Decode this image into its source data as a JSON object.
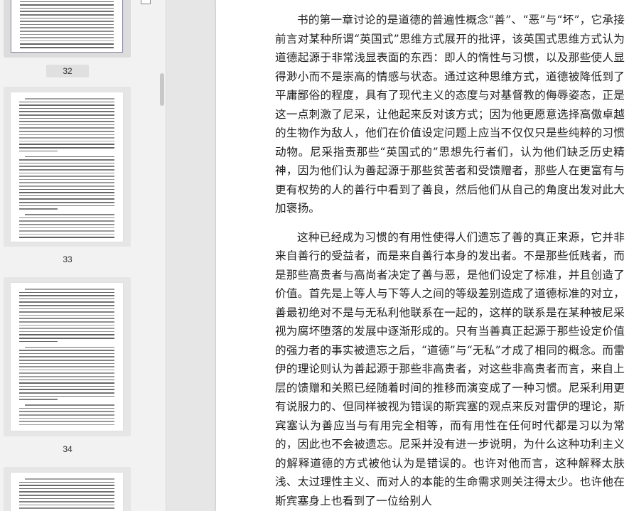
{
  "sidebar": {
    "thumbnails": [
      {
        "page_label": "32",
        "selected": true
      },
      {
        "page_label": "33",
        "selected": false
      },
      {
        "page_label": "34",
        "selected": false
      },
      {
        "page_label": "",
        "selected": false
      }
    ]
  },
  "document": {
    "paragraphs": [
      "书的第一章讨论的是道德的普遍性概念“善”、“恶”与“坏”，它承接前言对某种所谓“英国式”思维方式展开的批评，该英国式思维方式认为道德起源于非常浅显表面的东西：即人的惰性与习惯，以及那些使人显得渺小而不是崇高的情感与状态。通过这种思维方式，道德被降低到了平庸鄙俗的程度，具有了现代主义的态度与对基督教的侮辱姿态，正是这一点刺激了尼采，让他起来反对该方式；因为他更愿意选择高傲卓越的生物作为敌人，他们在价值设定问题上应当不仅仅只是些纯粹的习惯动物。尼采指责那些“英国式的”思想先行者们，认为他们缺乏历史精神，因为他们认为善起源于那些贫苦者和受馈赠者，那些人在更富有与更有权势的人的善行中看到了善良，然后他们从自己的角度出发对此大加褒扬。",
      "这种已经成为习惯的有用性使得人们遗忘了善的真正来源，它并非来自善行的受益者，而是来自善行本身的发出者。不是那些低贱者，而是那些高贵者与高尚者决定了善与恶，是他们设定了标准，并且创造了价值。首先是上等人与下等人之间的等级差别造成了道德标准的对立，善最初绝对不是与无私利他联系在一起的，这样的联系是在某种被尼采视为腐坏堕落的发展中逐渐形成的。只有当善真正起源于那些设定价值的强力者的事实被遗忘之后，“道德”与“无私”才成了相同的概念。而雷伊的理论则认为善起源于那些非高贵者，对这些非高贵者而言，来自上层的馈赠和关照已经随着时间的推移而演变成了一种习惯。尼采利用更有说服力的、但同样被视为错误的斯宾塞的观点来反对雷伊的理论，斯宾塞认为善应当与有用完全相等，而有用性在任何时代都是习以为常的，因此也不会被遗忘。尼采并没有进一步说明，为什么这种功利主义的解释道德的方式被他认为是错误的。也许对他而言，这种解释太肤浅、太过理性主义、而对人的本能的生命需求则关注得太少。也许他在斯宾塞身上也看到了一位给别人"
    ]
  }
}
